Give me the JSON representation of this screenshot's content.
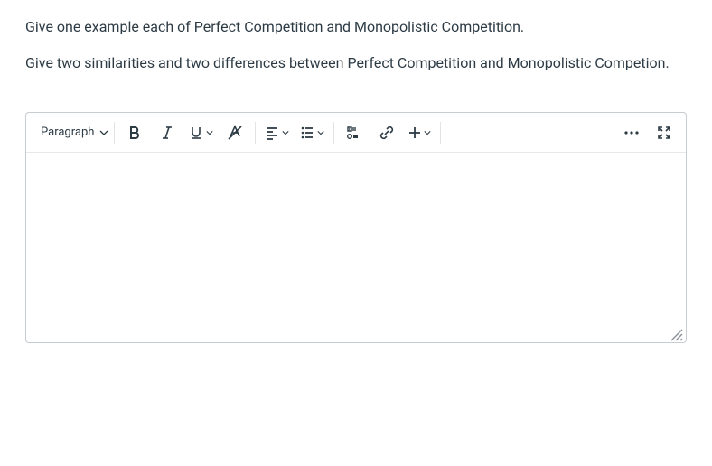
{
  "question": {
    "line1": "Give one example each of Perfect Competition and Monopolistic Competition.",
    "line2": "Give two similarities and two differences between Perfect Competition and Monopolistic Competion."
  },
  "editor": {
    "block_type_label": "Paragraph",
    "content": ""
  }
}
